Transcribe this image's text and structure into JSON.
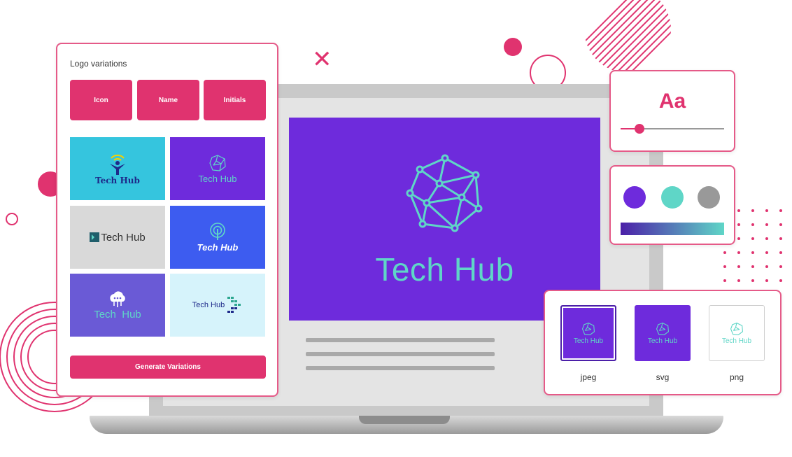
{
  "panel": {
    "title": "Logo variations",
    "tabs": [
      "Icon",
      "Name",
      "Initials"
    ],
    "generate_label": "Generate Variations",
    "tiles": [
      {
        "text": "Tech Hub",
        "bg": "#35c5de",
        "fg": "#1e2a8a",
        "icon": "person-wifi-icon"
      },
      {
        "text": "Tech Hub",
        "bg": "#6e2bdc",
        "fg": "#5fd6c7",
        "icon": "network-polyhedron-icon"
      },
      {
        "text": "Tech Hub",
        "bg": "#d9d9d9",
        "fg": "#333333",
        "icon": "square-mark-icon"
      },
      {
        "text": "Tech Hub",
        "bg": "#3d5cf0",
        "fg": "#ffffff",
        "icon": "signal-pin-icon"
      },
      {
        "text": "Tech  Hub",
        "bg": "#6a5ad6",
        "fg": "#5fd6c7",
        "icon": "cloud-circuit-icon"
      },
      {
        "text": "Tech Hub",
        "bg": "#d6f3fb",
        "fg": "#1e2a8a",
        "icon": "pixel-arrow-icon"
      }
    ]
  },
  "hero": {
    "title": "Tech Hub"
  },
  "typography": {
    "sample": "Aa",
    "slider_value": 0.18
  },
  "palette": {
    "colors": [
      "#6e2bdc",
      "#5fd6c7",
      "#999999"
    ]
  },
  "export": {
    "formats": [
      {
        "label": "jpeg",
        "logo_text": "Tech Hub"
      },
      {
        "label": "svg",
        "logo_text": "Tech Hub"
      },
      {
        "label": "png",
        "logo_text": "Tech Hub"
      }
    ]
  },
  "colors": {
    "accent": "#e0336f",
    "brand_purple": "#6e2bdc",
    "brand_teal": "#5fd6c7"
  }
}
